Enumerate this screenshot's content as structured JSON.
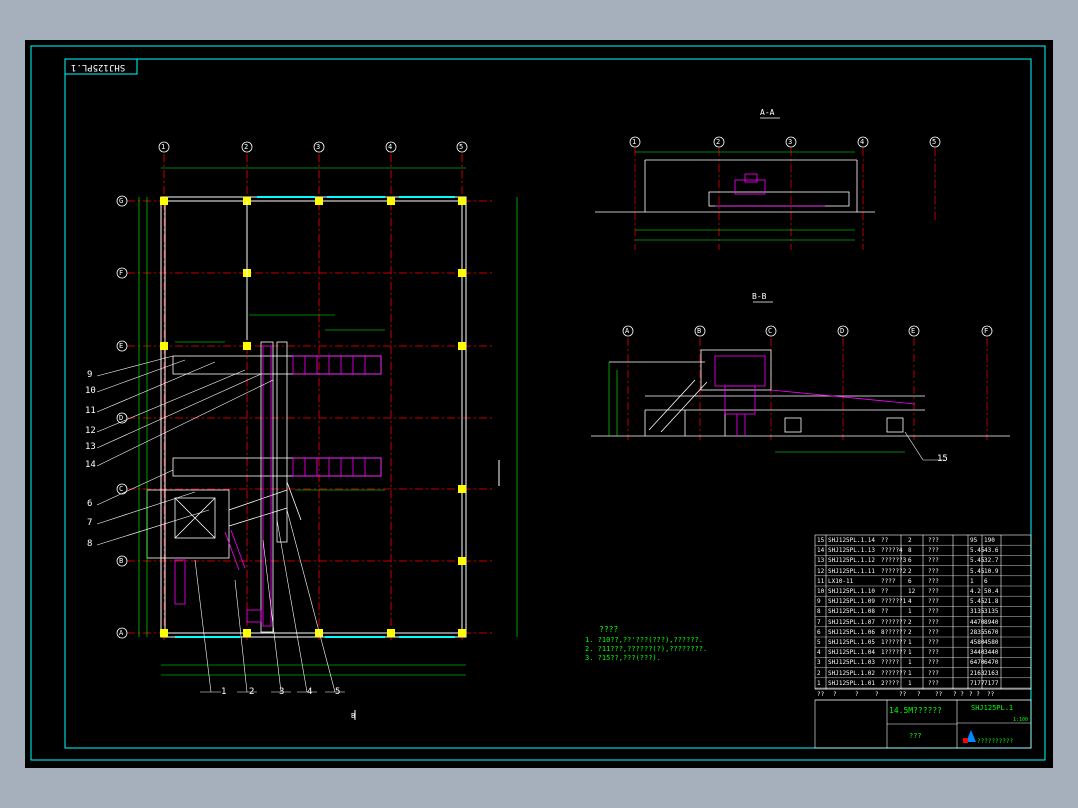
{
  "drawing_code_rotated": "SHJ125PL.1",
  "section_aa_title": "A-A",
  "section_bb_title": "B-B",
  "grid_cols": [
    "1",
    "2",
    "3",
    "4",
    "5"
  ],
  "grid_rows": [
    "G",
    "F",
    "E",
    "D",
    "C",
    "B",
    "A"
  ],
  "bb_cols": [
    "A",
    "B",
    "C",
    "D",
    "E",
    "F"
  ],
  "callouts_left": [
    "9",
    "10",
    "11",
    "12",
    "13",
    "14",
    "6",
    "7",
    "8"
  ],
  "callouts_bottom": [
    "1",
    "2",
    "3",
    "4",
    "5"
  ],
  "callout_15": "15",
  "section_mark_b": "B",
  "notes_title": "????",
  "notes": [
    "1. ?10??,??'???(???),??????.",
    "2. ?11???,??????(?),????????.",
    "3. ?15??,???(???)."
  ],
  "parts": [
    {
      "no": "15",
      "code": "SHJ125PL.1.14",
      "name": "??",
      "qty": "2",
      "mat": "???",
      "w1": "95",
      "w2": "190"
    },
    {
      "no": "14",
      "code": "SHJ125PL.1.13",
      "name": "?????4",
      "qty": "8",
      "mat": "???",
      "w1": "5.45",
      "w2": "43.6"
    },
    {
      "no": "13",
      "code": "SHJ125PL.1.12",
      "name": "??????3",
      "qty": "6",
      "mat": "???",
      "w1": "5.45",
      "w2": "32.7"
    },
    {
      "no": "12",
      "code": "SHJ125PL.1.11",
      "name": "??????2",
      "qty": "2",
      "mat": "???",
      "w1": "5.45",
      "w2": "10.9"
    },
    {
      "no": "11",
      "code": "LX10-11",
      "name": "????",
      "qty": "6",
      "mat": "???",
      "w1": "1",
      "w2": "6"
    },
    {
      "no": "10",
      "code": "SHJ125PL.1.10",
      "name": "??",
      "qty": "12",
      "mat": "???",
      "w1": "4.2",
      "w2": "50.4"
    },
    {
      "no": "9",
      "code": "SHJ125PL.1.09",
      "name": "??????1",
      "qty": "4",
      "mat": "???",
      "w1": "5.45",
      "w2": "21.8"
    },
    {
      "no": "8",
      "code": "SHJ125PL.1.08",
      "name": "??",
      "qty": "1",
      "mat": "???",
      "w1": "3135",
      "w2": "3135"
    },
    {
      "no": "7",
      "code": "SHJ125PL.1.07",
      "name": "???????",
      "qty": "2",
      "mat": "???",
      "w1": "4470",
      "w2": "8940"
    },
    {
      "no": "6",
      "code": "SHJ125PL.1.06",
      "name": "8??????",
      "qty": "2",
      "mat": "???",
      "w1": "2835",
      "w2": "5670"
    },
    {
      "no": "5",
      "code": "SHJ125PL.1.05",
      "name": "1??????",
      "qty": "1",
      "mat": "???",
      "w1": "4580",
      "w2": "4580"
    },
    {
      "no": "4",
      "code": "SHJ125PL.1.04",
      "name": "1??????",
      "qty": "1",
      "mat": "???",
      "w1": "3440",
      "w2": "3440"
    },
    {
      "no": "3",
      "code": "SHJ125PL.1.03",
      "name": "?????",
      "qty": "1",
      "mat": "???",
      "w1": "6470",
      "w2": "6470"
    },
    {
      "no": "2",
      "code": "SHJ125PL.1.02",
      "name": "???????",
      "qty": "1",
      "mat": "???",
      "w1": "2163",
      "w2": "2163"
    },
    {
      "no": "1",
      "code": "SHJ125PL.1.01",
      "name": "2????",
      "qty": "1",
      "mat": "???",
      "w1": "7177",
      "w2": "7177"
    }
  ],
  "parts_header": [
    "??",
    "?",
    "?",
    "?",
    "??",
    "?",
    "??",
    "? ?",
    "? ?",
    "??"
  ],
  "title_name": "14.5M??????",
  "title_code": "SHJ125PL.1",
  "title_company": "???",
  "title_bottom": "??????????",
  "title_scale": "1:100",
  "colors": {
    "frame": "#00ffff",
    "axis": "#ff0000",
    "structure": "#ffffff",
    "equipment": "#ff00ff",
    "dims": "#00ff00",
    "columns": "#ffff00",
    "bg": "#000000"
  }
}
